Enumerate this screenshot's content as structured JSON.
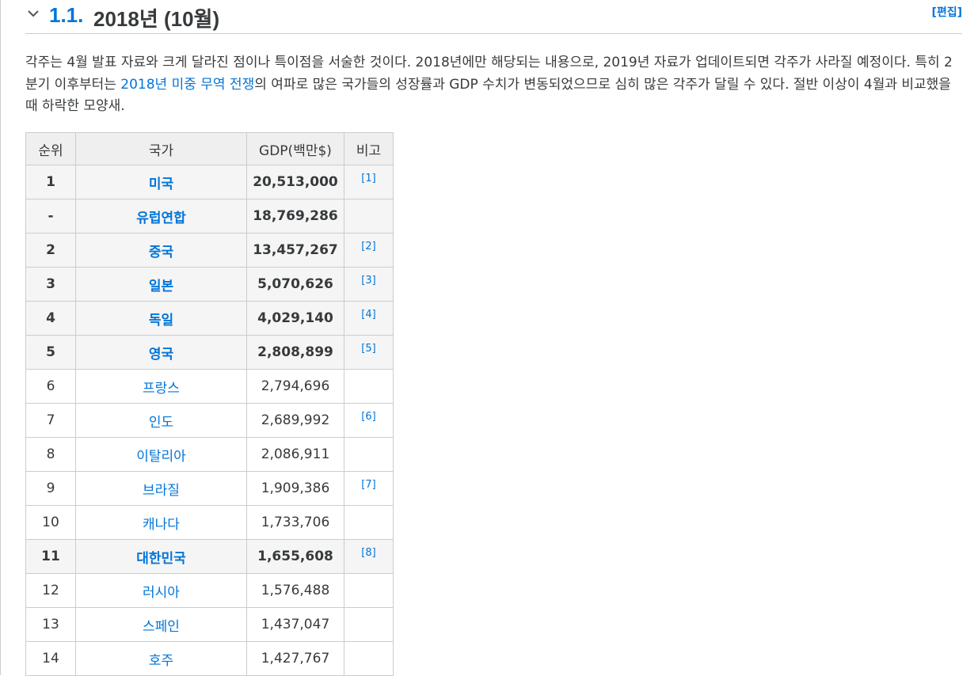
{
  "section": {
    "number": "1.1.",
    "title": "2018년 (10월)",
    "edit_label": "[편집]"
  },
  "intro": {
    "before_link": "각주는 4월 발표 자료와 크게 달라진 점이나 특이점을 서술한 것이다. 2018년에만 해당되는 내용으로, 2019년 자료가 업데이트되면 각주가 사라질 예정이다. 특히 2분기 이후부터는 ",
    "link_text": "2018년 미중 무역 전쟁",
    "after_link": "의 여파로 많은 국가들의 성장률과 GDP 수치가 변동되었으므로 심히 많은 각주가 달릴 수 있다. 절반 이상이 4월과 비교했을 때 하락한 모양새."
  },
  "table": {
    "headers": [
      "순위",
      "국가",
      "GDP(백만$)",
      "비고"
    ],
    "rows": [
      {
        "rank": "1",
        "country": "미국",
        "gdp": "20,513,000",
        "note": "[1]",
        "highlight": true
      },
      {
        "rank": "-",
        "country": "유럽연합",
        "gdp": "18,769,286",
        "note": "",
        "highlight": true
      },
      {
        "rank": "2",
        "country": "중국",
        "gdp": "13,457,267",
        "note": "[2]",
        "highlight": true
      },
      {
        "rank": "3",
        "country": "일본",
        "gdp": "5,070,626",
        "note": "[3]",
        "highlight": true
      },
      {
        "rank": "4",
        "country": "독일",
        "gdp": "4,029,140",
        "note": "[4]",
        "highlight": true
      },
      {
        "rank": "5",
        "country": "영국",
        "gdp": "2,808,899",
        "note": "[5]",
        "highlight": true
      },
      {
        "rank": "6",
        "country": "프랑스",
        "gdp": "2,794,696",
        "note": "",
        "highlight": false
      },
      {
        "rank": "7",
        "country": "인도",
        "gdp": "2,689,992",
        "note": "[6]",
        "highlight": false
      },
      {
        "rank": "8",
        "country": "이탈리아",
        "gdp": "2,086,911",
        "note": "",
        "highlight": false
      },
      {
        "rank": "9",
        "country": "브라질",
        "gdp": "1,909,386",
        "note": "[7]",
        "highlight": false
      },
      {
        "rank": "10",
        "country": "캐나다",
        "gdp": "1,733,706",
        "note": "",
        "highlight": false
      },
      {
        "rank": "11",
        "country": "대한민국",
        "gdp": "1,655,608",
        "note": "[8]",
        "highlight": true
      },
      {
        "rank": "12",
        "country": "러시아",
        "gdp": "1,576,488",
        "note": "",
        "highlight": false
      },
      {
        "rank": "13",
        "country": "스페인",
        "gdp": "1,437,047",
        "note": "",
        "highlight": false
      },
      {
        "rank": "14",
        "country": "호주",
        "gdp": "1,427,767",
        "note": "",
        "highlight": false
      }
    ]
  },
  "icons": {
    "collapse": "chevron-down-icon"
  },
  "colors": {
    "link": "#0275d8",
    "text": "#373a3c",
    "border": "#cccccc",
    "header_bg": "#efefef",
    "highlight_bg": "#f5f5f5"
  }
}
